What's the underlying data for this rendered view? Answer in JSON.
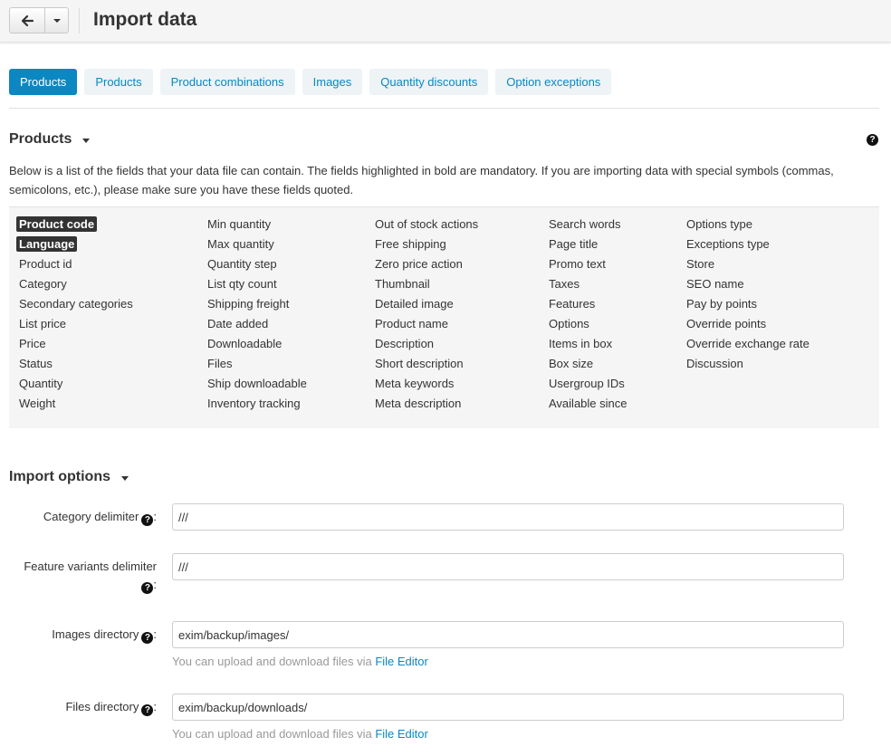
{
  "header": {
    "title": "Import data",
    "back_icon": "arrow-left-icon"
  },
  "tabs": [
    {
      "label": "Products",
      "active": true
    },
    {
      "label": "Products",
      "active": false
    },
    {
      "label": "Product combinations",
      "active": false
    },
    {
      "label": "Images",
      "active": false
    },
    {
      "label": "Quantity discounts",
      "active": false
    },
    {
      "label": "Option exceptions",
      "active": false
    }
  ],
  "products_section": {
    "title": "Products",
    "help_glyph": "?",
    "intro": "Below is a list of the fields that your data file can contain. The fields highlighted in bold are mandatory. If you are importing data with special symbols (commas, semicolons, etc.), please make sure you have these fields quoted."
  },
  "fields": {
    "col1": [
      {
        "label": "Product code",
        "mandatory": true
      },
      {
        "label": "Language",
        "mandatory": true
      },
      {
        "label": "Product id"
      },
      {
        "label": "Category"
      },
      {
        "label": "Secondary categories"
      },
      {
        "label": "List price"
      },
      {
        "label": "Price"
      },
      {
        "label": "Status"
      },
      {
        "label": "Quantity"
      },
      {
        "label": "Weight"
      }
    ],
    "col2": [
      {
        "label": "Min quantity"
      },
      {
        "label": "Max quantity"
      },
      {
        "label": "Quantity step"
      },
      {
        "label": "List qty count"
      },
      {
        "label": "Shipping freight"
      },
      {
        "label": "Date added"
      },
      {
        "label": "Downloadable"
      },
      {
        "label": "Files"
      },
      {
        "label": "Ship downloadable"
      },
      {
        "label": "Inventory tracking"
      }
    ],
    "col3": [
      {
        "label": "Out of stock actions"
      },
      {
        "label": "Free shipping"
      },
      {
        "label": "Zero price action"
      },
      {
        "label": "Thumbnail"
      },
      {
        "label": "Detailed image"
      },
      {
        "label": "Product name"
      },
      {
        "label": "Description"
      },
      {
        "label": "Short description"
      },
      {
        "label": "Meta keywords"
      },
      {
        "label": "Meta description"
      }
    ],
    "col4": [
      {
        "label": "Search words"
      },
      {
        "label": "Page title"
      },
      {
        "label": "Promo text"
      },
      {
        "label": "Taxes"
      },
      {
        "label": "Features"
      },
      {
        "label": "Options"
      },
      {
        "label": "Items in box"
      },
      {
        "label": "Box size"
      },
      {
        "label": "Usergroup IDs"
      },
      {
        "label": "Available since"
      }
    ],
    "col5": [
      {
        "label": "Options type"
      },
      {
        "label": "Exceptions type"
      },
      {
        "label": "Store"
      },
      {
        "label": "SEO name"
      },
      {
        "label": "Pay by points"
      },
      {
        "label": "Override points"
      },
      {
        "label": "Override exchange rate"
      },
      {
        "label": "Discussion"
      }
    ]
  },
  "import_options": {
    "title": "Import options",
    "category_delimiter": {
      "label": "Category delimiter",
      "value": "///"
    },
    "feature_variants_delimiter": {
      "label_line1": "Feature variants delimiter",
      "value": "///"
    },
    "images_directory": {
      "label": "Images directory",
      "value": "exim/backup/images/"
    },
    "files_directory": {
      "label": "Files directory",
      "value": "exim/backup/downloads/"
    },
    "hint_text": "You can upload and download files via",
    "hint_link": "File Editor",
    "colon": ":"
  }
}
